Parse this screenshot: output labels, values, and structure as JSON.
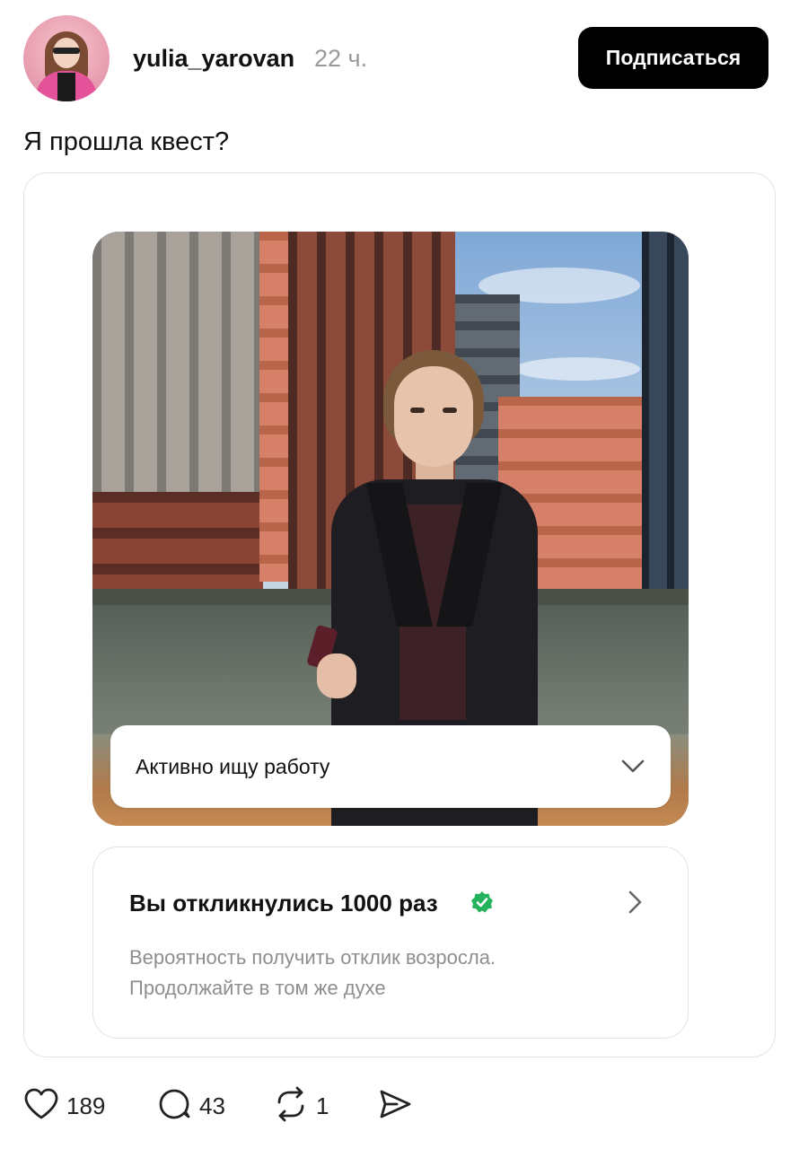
{
  "post": {
    "username": "yulia_yarovan",
    "time": "22 ч.",
    "subscribe_label": "Подписаться",
    "text": "Я прошла квест?"
  },
  "card": {
    "status_label": "Активно ищу работу",
    "stats_title": "Вы откликнулись 1000 раз",
    "stats_line1": "Вероятность получить отклик возросла.",
    "stats_line2": "Продолжайте в том же духе",
    "accent": "#23b35c"
  },
  "actions": {
    "likes": "189",
    "comments": "43",
    "reposts": "1"
  },
  "icons": [
    "heart-icon",
    "comment-icon",
    "repost-icon",
    "share-icon",
    "chevron-down-icon",
    "chevron-right-icon",
    "verified-check-icon"
  ]
}
